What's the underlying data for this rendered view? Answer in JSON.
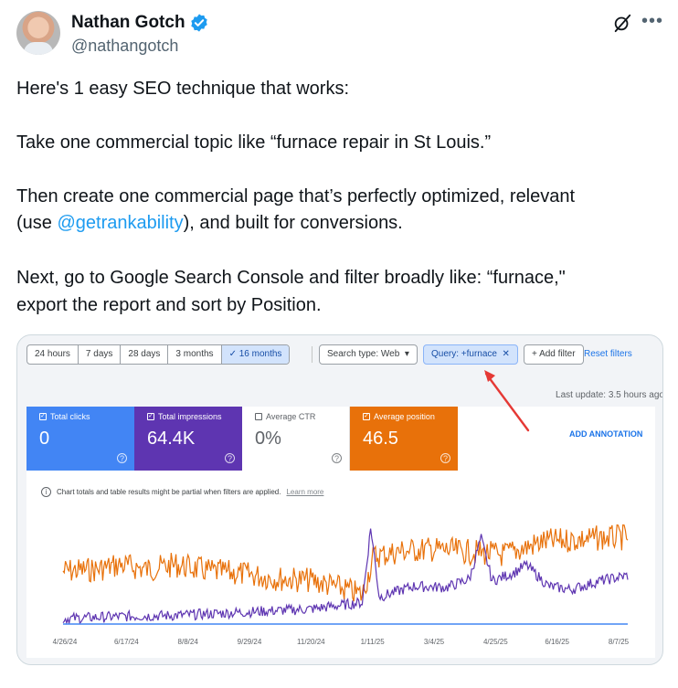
{
  "tweet": {
    "display_name": "Nathan Gotch",
    "handle": "@nathangotch",
    "line1": "Here's 1 easy SEO technique that works:",
    "line2": "Take one commercial topic like “furnace repair in St Louis.”",
    "line3": "Then create one commercial page that’s perfectly optimized, relevant",
    "line4_pre": "(use ",
    "line4_mention": "@getrankability",
    "line4_post": "), and built for conversions.",
    "line5": "Next, go to Google Search Console and filter broadly like: “furnace,\"",
    "line6": "export the report and sort by Position.",
    "icons": {
      "verified": "verified-badge-icon",
      "grok": "grok-icon",
      "more": "more-icon"
    },
    "more_glyph": "•••"
  },
  "gsc": {
    "date_ranges": [
      "24 hours",
      "7 days",
      "28 days",
      "3 months",
      "16 months"
    ],
    "active_range": "✓  16 months",
    "search_type": "Search type: Web",
    "search_type_caret": "▾",
    "query_filter": "Query: +furnace",
    "query_close": "✕",
    "add_filter": "+  Add filter",
    "reset_filters": "Reset filters",
    "last_update": "Last update: 3.5 hours ago",
    "metrics": {
      "clicks": {
        "label": "Total clicks",
        "value": "0",
        "checked": true
      },
      "impressions": {
        "label": "Total impressions",
        "value": "64.4K",
        "checked": true
      },
      "ctr": {
        "label": "Average CTR",
        "value": "0%",
        "checked": false
      },
      "position": {
        "label": "Average position",
        "value": "46.5",
        "checked": true
      }
    },
    "check_glyph": "✓",
    "help_glyph": "?",
    "add_annotation": "ADD ANNOTATION",
    "info_glyph": "i",
    "info_text": "Chart totals and table results might be partial when filters are applied.",
    "learn_more": "Learn more",
    "colors": {
      "clicks": "#4285f4",
      "impressions": "#5e35b1",
      "position": "#e8710a",
      "annotation_arrow": "#e53935"
    }
  },
  "chart_data": {
    "type": "line",
    "x_ticks": [
      "4/26/24",
      "6/17/24",
      "8/8/24",
      "9/29/24",
      "11/20/24",
      "1/11/25",
      "3/4/25",
      "4/25/25",
      "6/16/25",
      "8/7/25"
    ],
    "y_axis": "none (unlabeled)",
    "series": [
      {
        "name": "Average position",
        "color": "#e8710a",
        "shape": [
          [
            0,
            0.52
          ],
          [
            0.06,
            0.5
          ],
          [
            0.1,
            0.45
          ],
          [
            0.15,
            0.5
          ],
          [
            0.2,
            0.45
          ],
          [
            0.26,
            0.52
          ],
          [
            0.32,
            0.55
          ],
          [
            0.38,
            0.6
          ],
          [
            0.44,
            0.62
          ],
          [
            0.5,
            0.72
          ],
          [
            0.53,
            0.78
          ],
          [
            0.55,
            0.36
          ],
          [
            0.6,
            0.3
          ],
          [
            0.65,
            0.28
          ],
          [
            0.7,
            0.3
          ],
          [
            0.74,
            0.32
          ],
          [
            0.78,
            0.34
          ],
          [
            0.8,
            0.3
          ],
          [
            0.85,
            0.2
          ],
          [
            0.9,
            0.18
          ],
          [
            0.95,
            0.16
          ],
          [
            1,
            0.15
          ]
        ]
      },
      {
        "name": "Total impressions",
        "color": "#5e35b1",
        "shape": [
          [
            0,
            0.05
          ],
          [
            0.1,
            0.07
          ],
          [
            0.2,
            0.08
          ],
          [
            0.28,
            0.1
          ],
          [
            0.36,
            0.12
          ],
          [
            0.44,
            0.14
          ],
          [
            0.5,
            0.18
          ],
          [
            0.53,
            0.2
          ],
          [
            0.545,
            0.9
          ],
          [
            0.56,
            0.25
          ],
          [
            0.62,
            0.35
          ],
          [
            0.68,
            0.34
          ],
          [
            0.72,
            0.42
          ],
          [
            0.74,
            0.8
          ],
          [
            0.76,
            0.4
          ],
          [
            0.8,
            0.48
          ],
          [
            0.82,
            0.55
          ],
          [
            0.86,
            0.35
          ],
          [
            0.9,
            0.32
          ],
          [
            0.95,
            0.4
          ],
          [
            1,
            0.45
          ]
        ]
      },
      {
        "name": "Total clicks",
        "color": "#4285f4",
        "constant": 0
      }
    ]
  }
}
